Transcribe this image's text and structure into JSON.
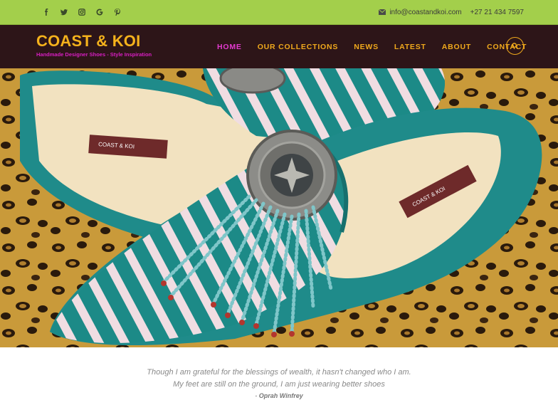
{
  "topbar": {
    "social": [
      "facebook-icon",
      "twitter-icon",
      "instagram-icon",
      "google-icon",
      "pinterest-icon"
    ],
    "email": "info@coastandkoi.com",
    "phone": "+27 21 434 7597"
  },
  "header": {
    "brand": "COAST & KOI",
    "tagline": "Handmade Designer Shoes - Style Inspiration",
    "nav": [
      "HOME",
      "OUR COLLECTIONS",
      "NEWS",
      "LATEST",
      "ABOUT",
      "CONTACT"
    ],
    "active_nav": "HOME"
  },
  "hero": {
    "label_left": "COAST & KOI",
    "label_right": "COAST & KOI"
  },
  "quote": {
    "line1": "Though I am grateful for the blessings of wealth, it hasn't changed who I am.",
    "line2": "My feet are still on the ground, I am just wearing better shoes",
    "dash": "- ",
    "author": "Oprah Winfrey"
  },
  "colors": {
    "topbar": "#a3cf4b",
    "header": "#2d1518",
    "brand": "#f5b21c",
    "tagline": "#d81fc2",
    "nav_active": "#e43ad0",
    "nav": "#f0a91c"
  }
}
